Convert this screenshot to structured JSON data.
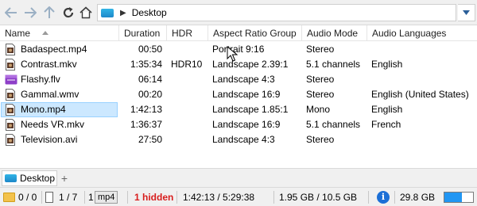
{
  "address": {
    "path": [
      "Desktop"
    ]
  },
  "columns": [
    "Name",
    "Duration",
    "HDR",
    "Aspect Ratio Group",
    "Audio Mode",
    "Audio Languages"
  ],
  "files": [
    {
      "name": "Badaspect.mp4",
      "duration": "00:50",
      "hdr": "",
      "aspect": "Portrait 9:16",
      "audio_mode": "Stereo",
      "audio_lang": "",
      "icon": "video-file-icon",
      "selected": false
    },
    {
      "name": "Contrast.mkv",
      "duration": "1:35:34",
      "hdr": "HDR10",
      "aspect": "Landscape 2.39:1",
      "audio_mode": "5.1 channels",
      "audio_lang": "English",
      "icon": "video-file-icon",
      "selected": false
    },
    {
      "name": "Flashy.flv",
      "duration": "06:14",
      "hdr": "",
      "aspect": "Landscape 4:3",
      "audio_mode": "Stereo",
      "audio_lang": "",
      "icon": "flash-video-icon",
      "selected": false
    },
    {
      "name": "Gammal.wmv",
      "duration": "00:20",
      "hdr": "",
      "aspect": "Landscape 16:9",
      "audio_mode": "Stereo",
      "audio_lang": "English (United States)",
      "icon": "video-file-icon",
      "selected": false
    },
    {
      "name": "Mono.mp4",
      "duration": "1:42:13",
      "hdr": "",
      "aspect": "Landscape 1.85:1",
      "audio_mode": "Mono",
      "audio_lang": "English",
      "icon": "video-file-icon",
      "selected": true
    },
    {
      "name": "Needs VR.mkv",
      "duration": "1:36:37",
      "hdr": "",
      "aspect": "Landscape 16:9",
      "audio_mode": "5.1 channels",
      "audio_lang": "French",
      "icon": "video-file-icon",
      "selected": false
    },
    {
      "name": "Television.avi",
      "duration": "27:50",
      "hdr": "",
      "aspect": "Landscape 4:3",
      "audio_mode": "Stereo",
      "audio_lang": "",
      "icon": "video-file-icon",
      "selected": false
    }
  ],
  "tabs": [
    {
      "label": "Desktop",
      "add_label": "+"
    }
  ],
  "status": {
    "folders": "0 / 0",
    "files": "1 / 7",
    "filter_count": "1",
    "filter_type": "mp4",
    "hidden": "1 hidden",
    "duration": "1:42:13 / 5:29:38",
    "size": "1.95 GB / 10.5 GB",
    "info": "i",
    "free_space": "29.8 GB",
    "drive_used_fraction": 0.62
  },
  "colors": {
    "accent": "#1c6fd6",
    "selection": "#cce8ff",
    "hidden_text": "#d81e1e",
    "drive_fill": "#2196f3"
  }
}
